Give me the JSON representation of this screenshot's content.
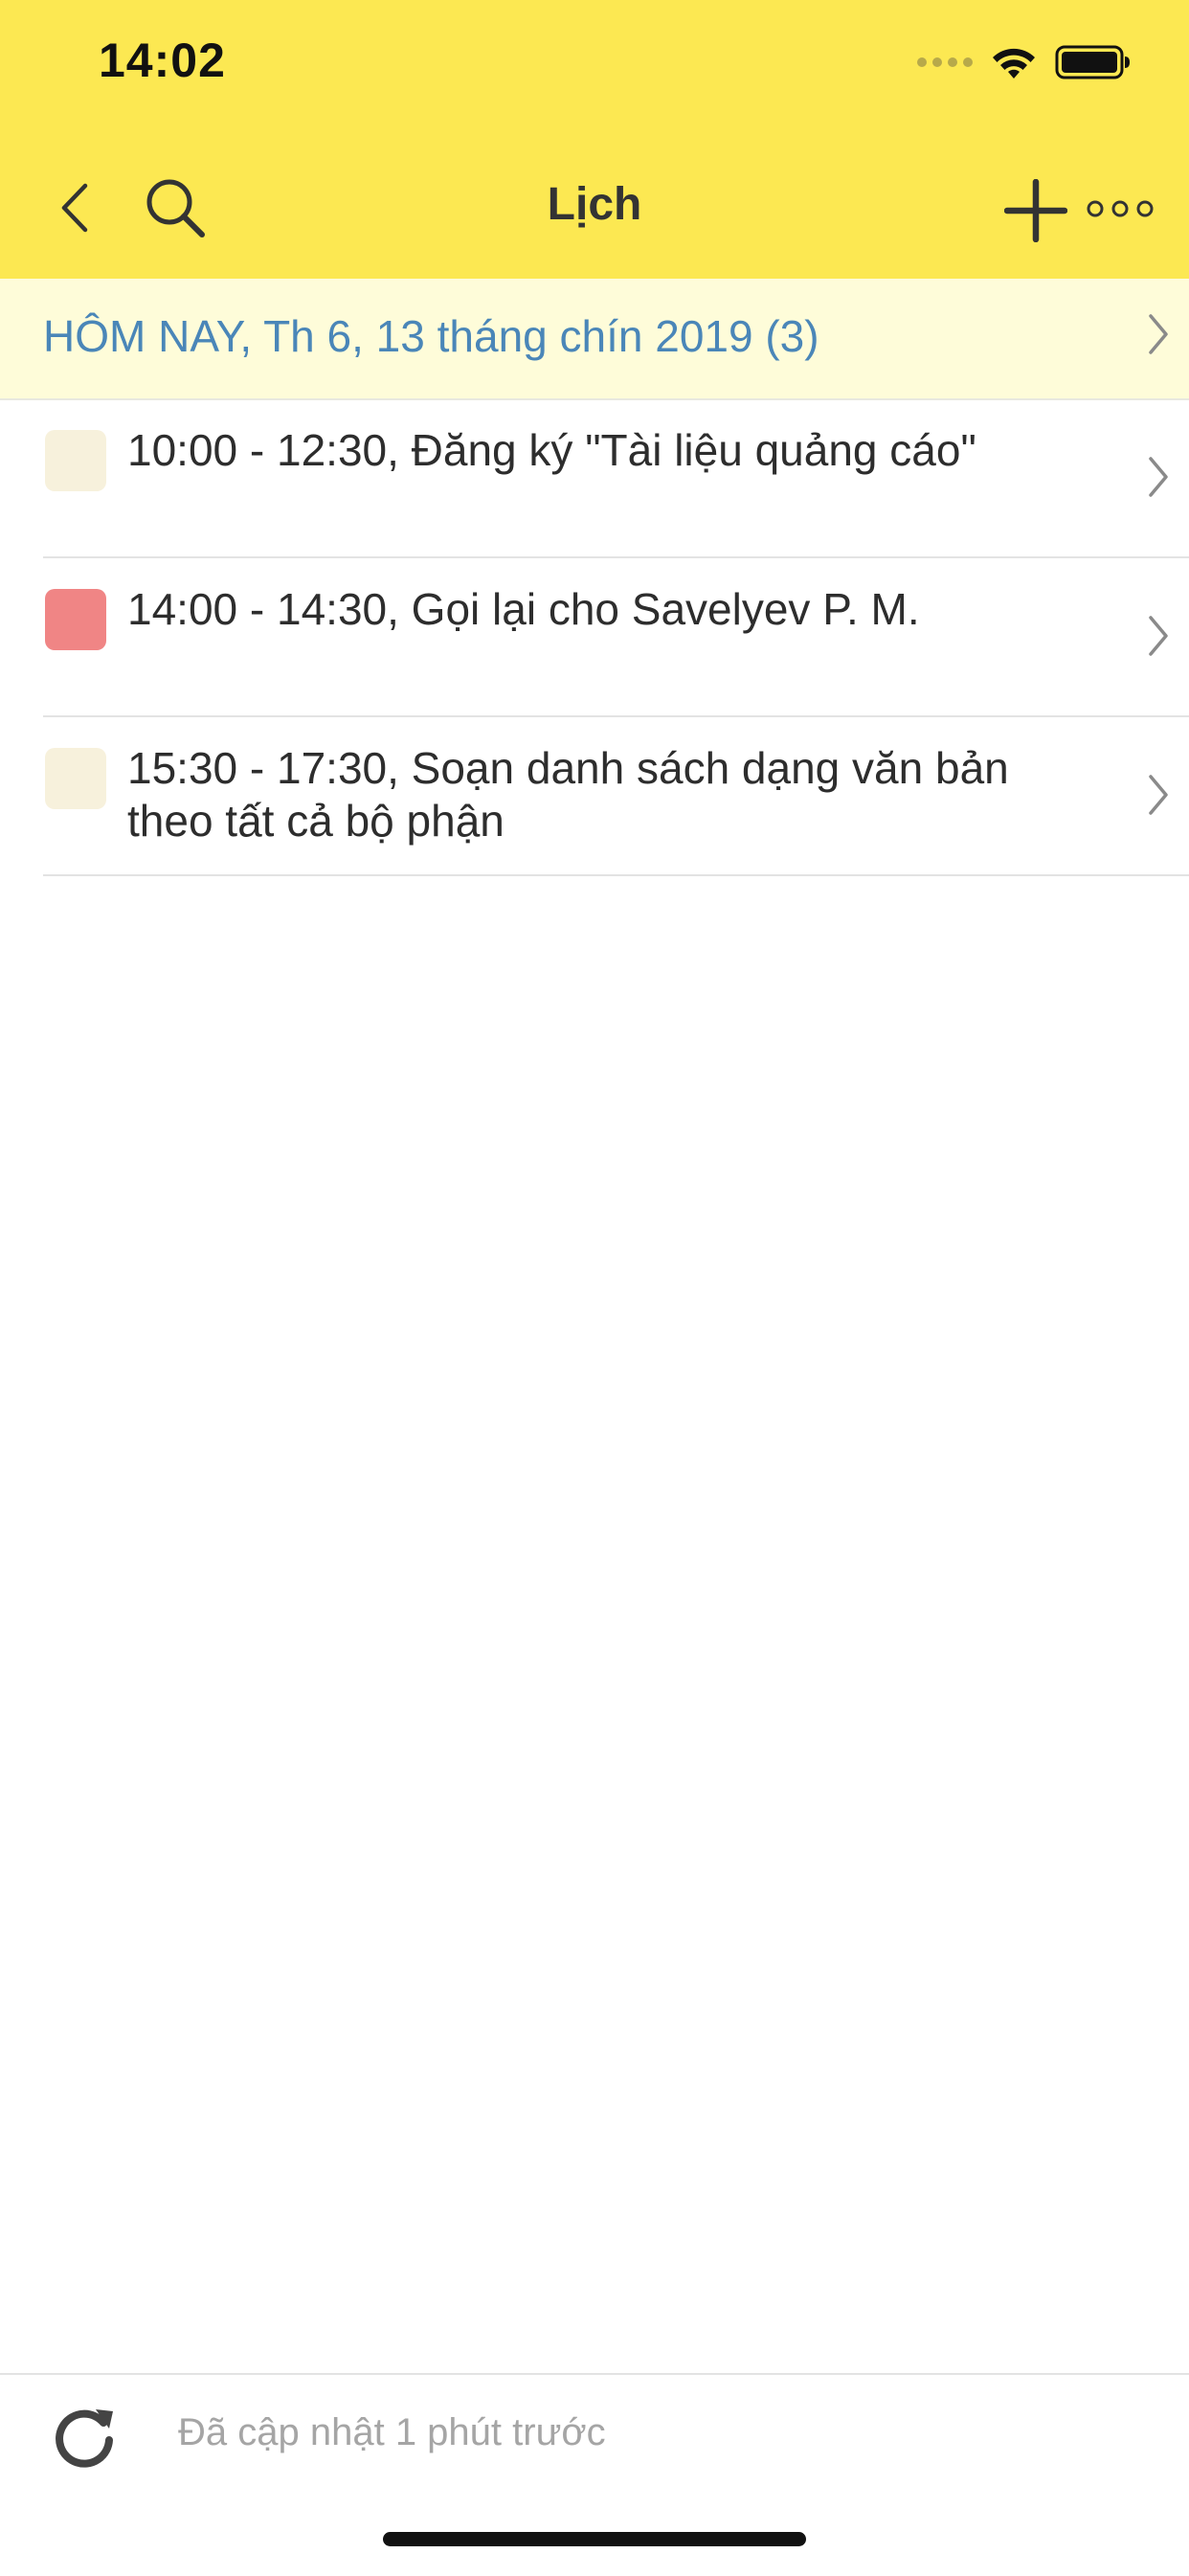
{
  "status_bar": {
    "time": "14:02",
    "wifi_icon": "wifi-icon",
    "battery_icon": "battery-icon"
  },
  "nav": {
    "title": "Lịch",
    "back_icon": "chevron-left-icon",
    "search_icon": "search-icon",
    "add_icon": "plus-icon",
    "more_icon": "more-horizontal-icon"
  },
  "today": {
    "label": "HÔM NAY, Th 6, 13 tháng chín 2019 (3)"
  },
  "events": [
    {
      "text": "10:00 - 12:30, Đăng ký \"Tài liệu quảng cáo\"",
      "color": "#f7f1dc"
    },
    {
      "text": "14:00 - 14:30, Gọi lại cho Savelyev P. M.",
      "color": "#f08585"
    },
    {
      "text": "15:30 - 17:30, Soạn danh sách dạng văn bản theo tất cả bộ phận",
      "color": "#f7f1dc"
    }
  ],
  "footer": {
    "refresh_icon": "refresh-icon",
    "updated": "Đã cập nhật 1 phút trước"
  },
  "colors": {
    "header_bg": "#fce852",
    "today_bg": "#fefcd9",
    "today_text": "#4a86b8"
  }
}
